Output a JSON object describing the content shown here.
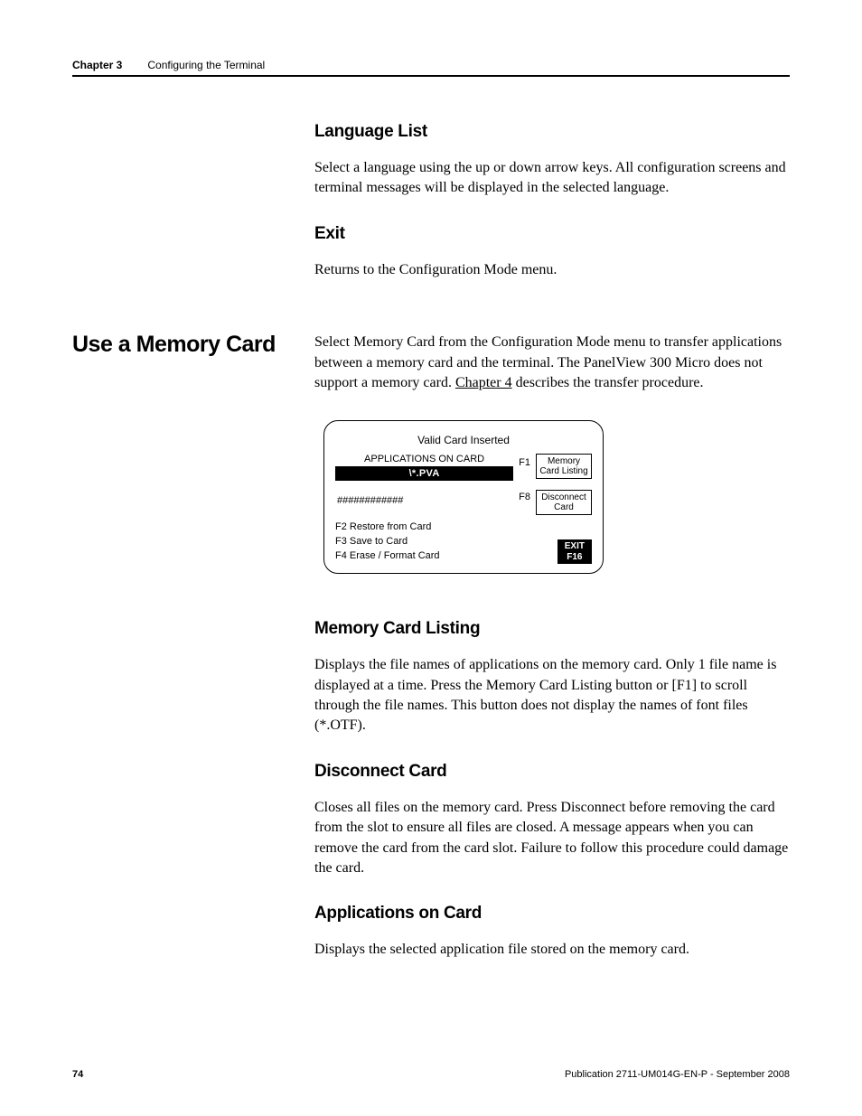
{
  "header": {
    "chapter": "Chapter 3",
    "title": "Configuring the Terminal"
  },
  "sec1": {
    "h_lang": "Language List",
    "p_lang": "Select a language using the up or down arrow keys. All configuration screens and terminal messages will be displayed in the selected language.",
    "h_exit": "Exit",
    "p_exit": "Returns to the Configuration Mode menu."
  },
  "sec2": {
    "title": "Use a Memory Card",
    "p_intro_a": "Select Memory Card from the Configuration Mode menu to transfer applications between a memory card and the terminal. The PanelView 300 Micro does not support a memory card. ",
    "chapter_link": "Chapter 4",
    "p_intro_b": " describes the transfer procedure."
  },
  "screen": {
    "top": "Valid Card Inserted",
    "apps_header": "APPLICATIONS ON CARD",
    "apps_bar": "\\*.PVA",
    "apps_hash": "############",
    "f1": "F1",
    "f8": "F8",
    "btn1": "Memory Card Listing",
    "btn2": "Disconnect Card",
    "opt1": "F2 Restore from Card",
    "opt2": "F3 Save to Card",
    "opt3": "F4 Erase / Format Card",
    "exit1": "EXIT",
    "exit2": "F16"
  },
  "sec3": {
    "h_listing": "Memory Card Listing",
    "p_listing": "Displays the file names of applications on the memory card. Only 1 file name is displayed at a time. Press the Memory Card Listing button or [F1] to scroll through the file names. This button does not display the names of font files (*.OTF).",
    "h_disc": "Disconnect Card",
    "p_disc": "Closes all files on the memory card. Press Disconnect before removing the card from the slot to ensure all files are closed. A message appears when you can remove the card from the card slot. Failure to follow this procedure could damage the card.",
    "h_apps": "Applications on Card",
    "p_apps": "Displays the selected application file stored on the memory card."
  },
  "footer": {
    "page": "74",
    "pub": "Publication 2711-UM014G-EN-P - September 2008"
  }
}
